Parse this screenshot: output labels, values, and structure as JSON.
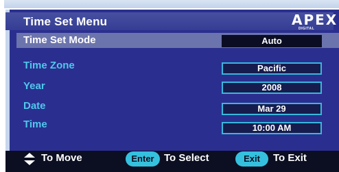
{
  "menu": {
    "title": "Time Set Menu",
    "brand_name": "APEX",
    "brand_sub": "DIGITAL"
  },
  "rows": [
    {
      "label": "Time Set Mode",
      "value": "Auto",
      "selected": true
    },
    {
      "label": "Time Zone",
      "value": "Pacific"
    },
    {
      "label": "Year",
      "value": "2008"
    },
    {
      "label": "Date",
      "value": "Mar 29"
    },
    {
      "label": "Time",
      "value": "10:00 AM"
    }
  ],
  "footer": {
    "move_label": "To Move",
    "enter_key": "Enter",
    "select_label": "To Select",
    "exit_key": "Exit",
    "exit_label": "To Exit",
    "move_icon": "up-down-arrow-icon"
  },
  "colors": {
    "panel": "#2a2f8f",
    "label": "#4fc8ec",
    "accent": "#35c1de",
    "footer": "#0c0e22"
  }
}
